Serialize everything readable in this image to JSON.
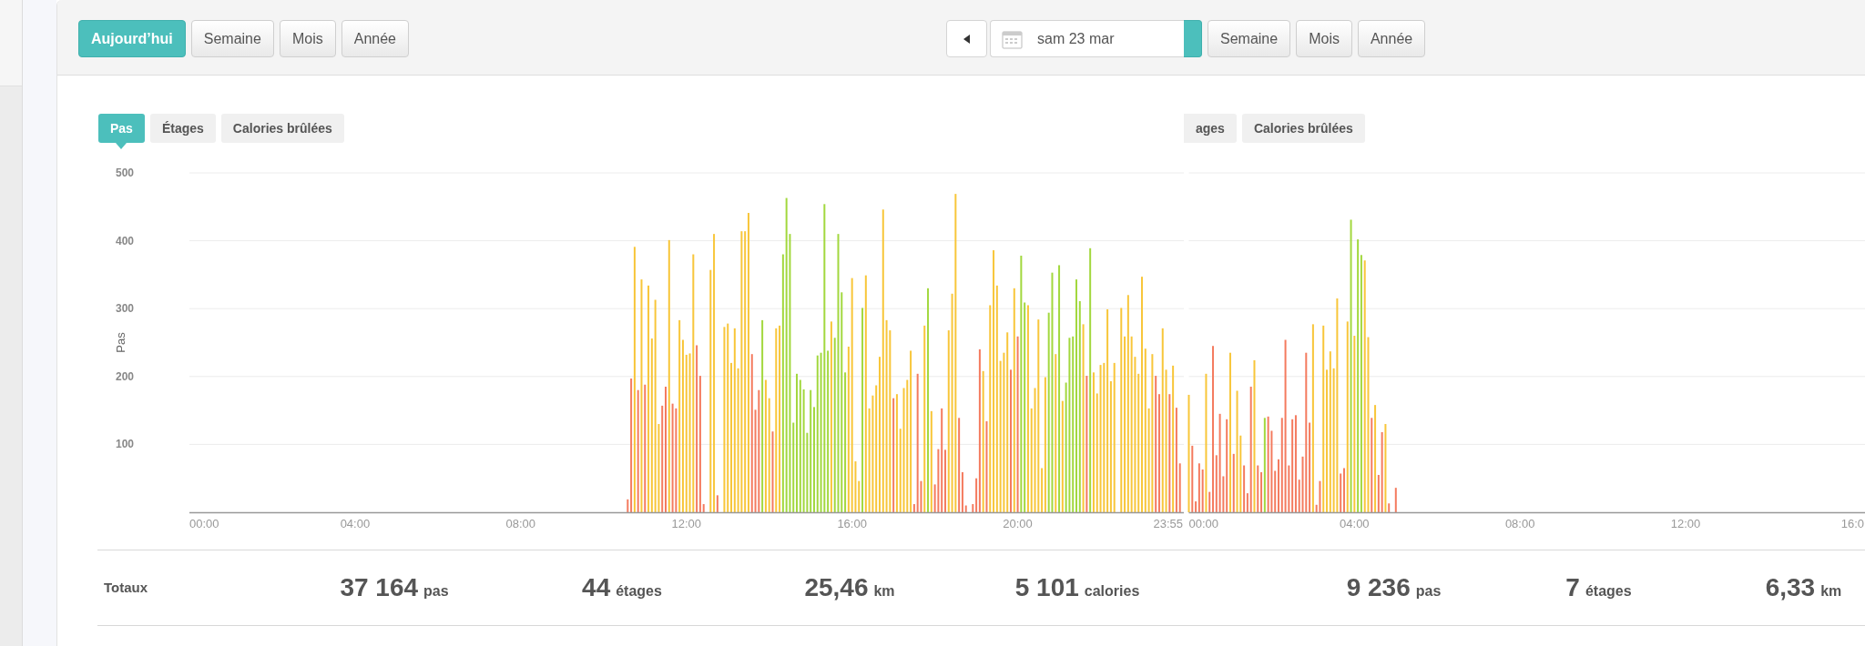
{
  "panels": [
    {
      "toolbar": {
        "buttons": [
          {
            "label": "Aujourd’hui",
            "selected": true
          },
          {
            "label": "Semaine",
            "selected": false
          },
          {
            "label": "Mois",
            "selected": false
          },
          {
            "label": "Année",
            "selected": false
          }
        ],
        "date_nav": {
          "date": "sam 23 mar"
        }
      },
      "tabs": [
        {
          "label": "Pas",
          "selected": true
        },
        {
          "label": "Étages",
          "selected": false
        },
        {
          "label": "Calories brûlées",
          "selected": false
        }
      ],
      "chart_data": {
        "type": "bar",
        "ylabel": "Pas",
        "stacked": true,
        "grid": true,
        "xlim": [
          0,
          1435
        ],
        "ylim": [
          0,
          500
        ],
        "xticks": [
          {
            "value": 0,
            "label": "00:00"
          },
          {
            "value": 240,
            "label": "04:00"
          },
          {
            "value": 480,
            "label": "08:00"
          },
          {
            "value": 720,
            "label": "12:00"
          },
          {
            "value": 960,
            "label": "16:00"
          },
          {
            "value": 1200,
            "label": "20:00"
          },
          {
            "value": 1435,
            "label": "23:55"
          }
        ],
        "yticks": [
          100,
          200,
          300,
          400,
          500
        ],
        "x": [
          635,
          640,
          645,
          650,
          655,
          660,
          665,
          670,
          675,
          680,
          685,
          690,
          695,
          700,
          705,
          710,
          715,
          720,
          725,
          730,
          735,
          740,
          745,
          755,
          760,
          765,
          775,
          780,
          785,
          790,
          795,
          800,
          805,
          810,
          815,
          820,
          825,
          830,
          835,
          840,
          845,
          850,
          855,
          860,
          865,
          870,
          875,
          880,
          885,
          890,
          895,
          900,
          905,
          910,
          915,
          920,
          925,
          930,
          935,
          940,
          945,
          950,
          955,
          960,
          965,
          970,
          975,
          980,
          985,
          990,
          995,
          1000,
          1005,
          1010,
          1015,
          1020,
          1025,
          1030,
          1035,
          1040,
          1045,
          1050,
          1055,
          1060,
          1065,
          1070,
          1075,
          1080,
          1085,
          1090,
          1095,
          1100,
          1105,
          1110,
          1115,
          1120,
          1125,
          1135,
          1140,
          1145,
          1150,
          1155,
          1160,
          1165,
          1170,
          1175,
          1180,
          1185,
          1190,
          1195,
          1200,
          1205,
          1210,
          1215,
          1220,
          1225,
          1230,
          1235,
          1240,
          1245,
          1250,
          1255,
          1260,
          1265,
          1270,
          1275,
          1280,
          1285,
          1290,
          1295,
          1300,
          1305,
          1310,
          1315,
          1320,
          1325,
          1330,
          1335,
          1340,
          1350,
          1355,
          1360,
          1365,
          1370,
          1375,
          1380,
          1385,
          1390,
          1395,
          1400,
          1405,
          1410,
          1415,
          1420,
          1425,
          1430,
          1435
        ],
        "series": [
          {
            "color": "#f47b5f",
            "values": [
              19,
              197,
              null,
              180,
              null,
              188,
              null,
              null,
              null,
              null,
              157,
              185,
              null,
              160,
              153,
              null,
              null,
              null,
              null,
              null,
              246,
              201,
              12,
              null,
              null,
              25,
              null,
              null,
              null,
              null,
              null,
              null,
              null,
              null,
              233,
              151,
              180,
              null,
              null,
              null,
              119,
              null,
              null,
              null,
              null,
              null,
              null,
              null,
              null,
              null,
              null,
              null,
              null,
              null,
              null,
              null,
              null,
              null,
              null,
              null,
              null,
              null,
              null,
              null,
              null,
              null,
              null,
              null,
              null,
              null,
              null,
              null,
              null,
              null,
              null,
              168,
              null,
              null,
              null,
              null,
              null,
              12,
              204,
              46,
              null,
              null,
              null,
              41,
              93,
              153,
              92,
              null,
              null,
              null,
              139,
              59,
              10,
              12,
              50,
              240,
              null,
              134,
              null,
              null,
              null,
              null,
              null,
              null,
              210,
              null,
              259,
              null,
              null,
              null,
              null,
              null,
              null,
              null,
              null,
              null,
              null,
              null,
              null,
              null,
              null,
              null,
              null,
              null,
              null,
              null,
              201,
              null,
              null,
              null,
              null,
              null,
              null,
              null,
              null,
              null,
              null,
              null,
              null,
              null,
              null,
              null,
              null,
              null,
              null,
              201,
              174,
              null,
              null,
              174,
              null,
              154,
              72
            ]
          },
          {
            "color": "#f8c63a",
            "values": [
              null,
              null,
              391,
              null,
              343,
              null,
              334,
              256,
              313,
              130,
              null,
              null,
              401,
              null,
              null,
              283,
              254,
              232,
              234,
              380,
              null,
              null,
              null,
              357,
              410,
              null,
              273,
              278,
              220,
              271,
              212,
              414,
              414,
              441,
              null,
              null,
              null,
              null,
              195,
              168,
              null,
              271,
              275,
              null,
              null,
              null,
              null,
              null,
              null,
              null,
              null,
              null,
              null,
              null,
              null,
              null,
              null,
              281,
              null,
              null,
              null,
              null,
              244,
              345,
              75,
              46,
              null,
              349,
              153,
              172,
              187,
              229,
              446,
              283,
              268,
              null,
              174,
              123,
              183,
              195,
              238,
              null,
              null,
              null,
              275,
              null,
              149,
              null,
              null,
              null,
              null,
              268,
              322,
              469,
              null,
              null,
              null,
              null,
              null,
              null,
              208,
              null,
              305,
              386,
              334,
              223,
              235,
              265,
              null,
              330,
              null,
              null,
              null,
              305,
              153,
              183,
              284,
              65,
              199,
              null,
              null,
              233,
              null,
              164,
              null,
              null,
              null,
              null,
              null,
              277,
              null,
              null,
              206,
              175,
              217,
              220,
              299,
              193,
              220,
              301,
              259,
              320,
              259,
              229,
              204,
              347,
              241,
              153,
              233,
              null,
              null,
              271,
              210,
              null,
              216,
              null,
              null
            ]
          },
          {
            "color": "#a2d83e",
            "values": [
              null,
              null,
              null,
              null,
              null,
              null,
              null,
              null,
              null,
              null,
              null,
              null,
              null,
              null,
              null,
              null,
              null,
              null,
              null,
              null,
              null,
              null,
              null,
              null,
              null,
              null,
              null,
              null,
              null,
              null,
              null,
              null,
              null,
              null,
              null,
              null,
              null,
              283,
              null,
              null,
              null,
              null,
              null,
              380,
              463,
              410,
              132,
              204,
              195,
              181,
              117,
              180,
              155,
              231,
              235,
              454,
              238,
              null,
              257,
              410,
              324,
              206,
              null,
              null,
              null,
              null,
              301,
              null,
              null,
              null,
              null,
              null,
              null,
              null,
              null,
              null,
              null,
              null,
              null,
              null,
              null,
              null,
              null,
              null,
              null,
              330,
              null,
              null,
              null,
              null,
              null,
              null,
              null,
              null,
              null,
              null,
              null,
              null,
              null,
              null,
              null,
              null,
              null,
              null,
              null,
              null,
              null,
              null,
              null,
              null,
              null,
              378,
              309,
              null,
              null,
              null,
              null,
              null,
              null,
              294,
              353,
              null,
              364,
              null,
              191,
              257,
              259,
              343,
              311,
              null,
              null,
              389,
              null,
              null,
              null,
              null,
              null,
              null,
              null,
              null,
              null,
              null,
              null,
              null,
              null,
              null,
              null,
              null,
              null,
              null,
              null,
              null,
              null,
              null,
              null,
              null,
              null
            ]
          }
        ]
      },
      "totals": {
        "label": "Totaux",
        "items": [
          {
            "value": "37 164",
            "unit": "pas"
          },
          {
            "value": "44",
            "unit": "étages"
          },
          {
            "value": "25,46",
            "unit": "km"
          },
          {
            "value": "5 101",
            "unit": "calories"
          }
        ]
      }
    },
    {
      "toolbar": {
        "buttons": [
          {
            "selected": true
          },
          {
            "label": "Semaine",
            "selected": false
          },
          {
            "label": "Mois",
            "selected": false
          },
          {
            "label": "Année",
            "selected": false
          }
        ]
      },
      "tabs": [
        {
          "label": "ages",
          "selected": false
        },
        {
          "label": "Calories brûlées",
          "selected": false
        }
      ],
      "chart_data": {
        "type": "bar",
        "stacked": true,
        "grid": true,
        "xlim": [
          0,
          980
        ],
        "ylim": [
          0,
          500
        ],
        "xticks": [
          {
            "value": 0,
            "label": "00:00"
          },
          {
            "value": 240,
            "label": "04:00"
          },
          {
            "value": 480,
            "label": "08:00"
          },
          {
            "value": 720,
            "label": "12:00"
          },
          {
            "value": 960,
            "label": "16:0"
          }
        ],
        "x": [
          0,
          5,
          10,
          15,
          20,
          25,
          30,
          35,
          40,
          45,
          50,
          55,
          60,
          65,
          70,
          75,
          80,
          85,
          90,
          95,
          100,
          105,
          110,
          115,
          120,
          125,
          130,
          135,
          140,
          145,
          150,
          155,
          160,
          165,
          170,
          175,
          180,
          185,
          190,
          195,
          200,
          205,
          210,
          215,
          220,
          225,
          230,
          235,
          240,
          245,
          250,
          255,
          260,
          265,
          270,
          275,
          280,
          285,
          290,
          300
        ],
        "series": [
          {
            "color": "#f47b5f",
            "values": [
              null,
              98,
              16,
              72,
              63,
              null,
              30,
              245,
              84,
              145,
              53,
              137,
              null,
              86,
              null,
              null,
              69,
              28,
              185,
              null,
              69,
              59,
              null,
              141,
              120,
              61,
              78,
              139,
              254,
              69,
              137,
              143,
              48,
              82,
              235,
              132,
              null,
              11,
              46,
              null,
              null,
              null,
              null,
              null,
              57,
              65,
              null,
              null,
              null,
              null,
              null,
              null,
              null,
              139,
              null,
              55,
              118,
              null,
              13,
              36
            ]
          },
          {
            "color": "#f8c63a",
            "values": [
              173,
              null,
              null,
              null,
              null,
              204,
              null,
              null,
              null,
              null,
              null,
              null,
              235,
              null,
              179,
              113,
              null,
              null,
              null,
              224,
              null,
              null,
              null,
              null,
              null,
              null,
              null,
              null,
              null,
              null,
              null,
              null,
              null,
              null,
              null,
              null,
              277,
              null,
              null,
              275,
              210,
              237,
              212,
              315,
              null,
              null,
              281,
              null,
              260,
              null,
              null,
              371,
              258,
              null,
              158,
              null,
              null,
              130,
              null,
              null
            ]
          },
          {
            "color": "#a2d83e",
            "values": [
              null,
              null,
              null,
              null,
              null,
              null,
              null,
              null,
              null,
              null,
              null,
              null,
              null,
              null,
              null,
              null,
              null,
              null,
              null,
              null,
              null,
              null,
              139,
              null,
              null,
              null,
              null,
              null,
              null,
              null,
              null,
              null,
              null,
              null,
              null,
              null,
              null,
              null,
              null,
              null,
              null,
              null,
              null,
              null,
              null,
              null,
              null,
              431,
              null,
              402,
              379,
              null,
              null,
              null,
              null,
              null,
              null,
              null,
              null,
              null
            ]
          }
        ]
      },
      "totals": {
        "items": [
          {
            "value": "9 236",
            "unit": "pas"
          },
          {
            "value": "7",
            "unit": "étages"
          },
          {
            "value": "6,33",
            "unit": "km"
          }
        ]
      }
    }
  ]
}
